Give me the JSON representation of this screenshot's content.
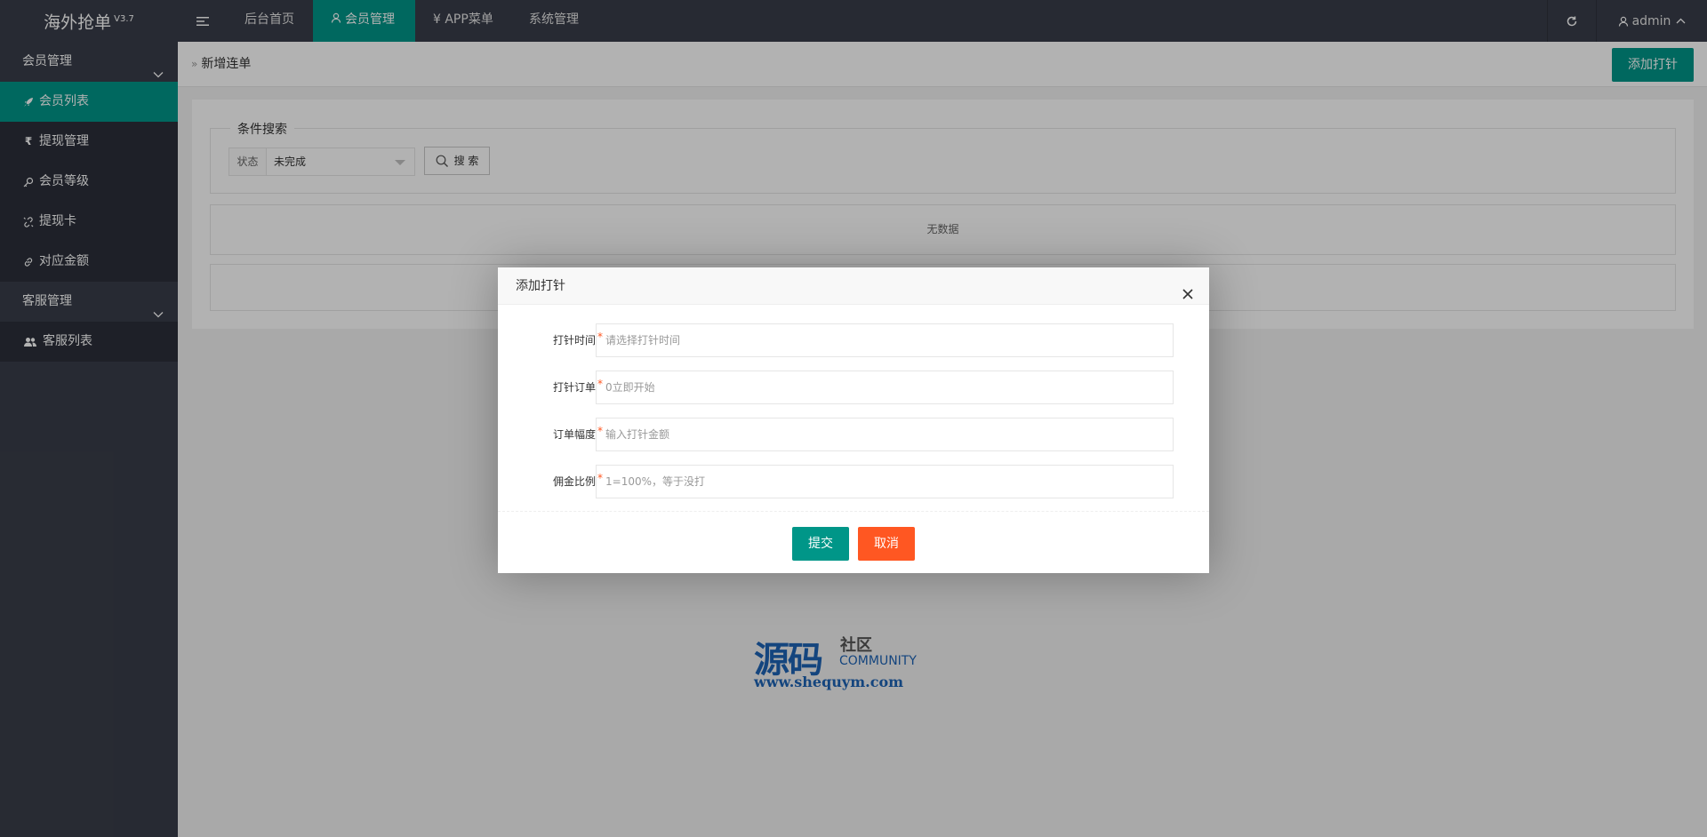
{
  "app": {
    "title": "海外抢单",
    "version": "V3.7"
  },
  "header": {
    "nav": [
      {
        "label": "后台首页"
      },
      {
        "label": "会员管理"
      },
      {
        "label": "¥ APP菜单"
      },
      {
        "label": "系统管理"
      }
    ],
    "user": "admin"
  },
  "sidebar": {
    "groups": [
      {
        "label": "会员管理",
        "items": [
          {
            "label": "会员列表",
            "icon": "rocket-icon"
          },
          {
            "label": "提现管理",
            "icon": "rupee-icon"
          },
          {
            "label": "会员等级",
            "icon": "key-icon"
          },
          {
            "label": "提现卡",
            "icon": "link-broken-icon"
          },
          {
            "label": "对应金额",
            "icon": "link-icon"
          }
        ]
      },
      {
        "label": "客服管理",
        "items": [
          {
            "label": "客服列表",
            "icon": "users-icon"
          }
        ]
      }
    ]
  },
  "page": {
    "breadcrumb": "新增连单",
    "add_button": "添加打针",
    "search": {
      "legend": "条件搜索",
      "status_label": "状态",
      "status_value": "未完成",
      "search_button": "搜 索"
    },
    "table_empty": "无数据"
  },
  "modal": {
    "title": "添加打针",
    "fields": [
      {
        "label": "打针时间",
        "placeholder": "请选择打针时间"
      },
      {
        "label": "打针订单",
        "placeholder": "0立即开始"
      },
      {
        "label": "订单幅度",
        "placeholder": "输入打针金额"
      },
      {
        "label": "佣金比例",
        "placeholder": "1=100%，等于没打"
      }
    ],
    "submit": "提交",
    "cancel": "取消"
  },
  "watermark": {
    "big": "源码",
    "small": "社区",
    "community": "COMMUNITY",
    "url": "www.shequym.com"
  },
  "colors": {
    "header": "#393d49",
    "accent": "#009688",
    "danger": "#ff5722"
  }
}
